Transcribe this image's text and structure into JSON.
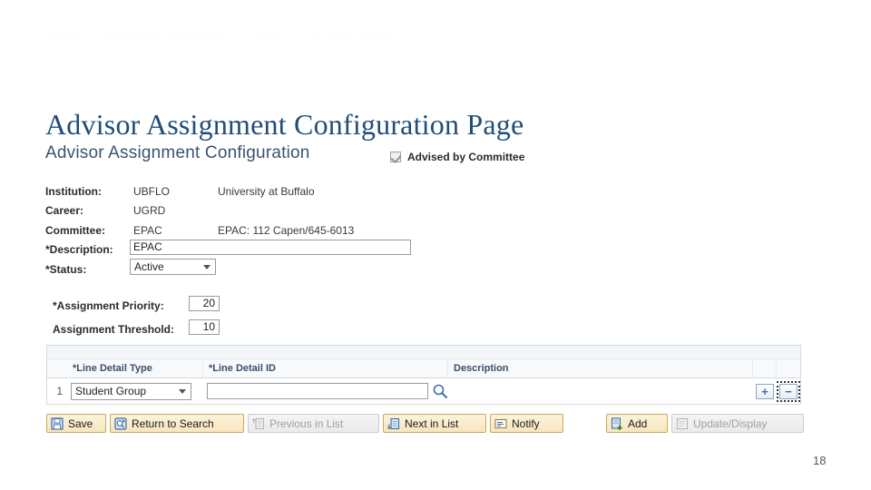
{
  "watermark": {
    "part1": "Advisor",
    "part2": "Assignment Configuration",
    "part3": "Page",
    "part4": "Committee Setup"
  },
  "page_title": "Advisor Assignment Configuration Page",
  "slide_number": "18",
  "form": {
    "subtitle": "Advisor Assignment Configuration",
    "committee_checkbox": {
      "label": "Advised by Committee",
      "checked": true
    },
    "fields": [
      {
        "label": "Institution:",
        "code": "UBFLO",
        "description": "University at Buffalo"
      },
      {
        "label": "Career:",
        "code": "UGRD",
        "description": ""
      },
      {
        "label": "Committee:",
        "code": "EPAC",
        "description": "EPAC: 112 Capen/645-6013"
      }
    ],
    "description": {
      "label": "*Description:",
      "value": "EPAC"
    },
    "status": {
      "label": "*Status:",
      "value": "Active"
    },
    "assignment_priority": {
      "label": "*Assignment Priority:",
      "value": "20"
    },
    "assignment_threshold": {
      "label": "Assignment Threshold:",
      "value": "10"
    }
  },
  "grid": {
    "columns": [
      {
        "key": "seq",
        "label": ""
      },
      {
        "key": "line_detail_type",
        "label": "*Line Detail Type"
      },
      {
        "key": "line_detail_id",
        "label": "*Line Detail ID"
      },
      {
        "key": "description",
        "label": "Description"
      }
    ],
    "rows": [
      {
        "seq": "1",
        "line_detail_type": "Student Group",
        "line_detail_id": "",
        "description": "",
        "lookup_icon": "search-icon",
        "add_row_label": "+",
        "delete_row_label": "−"
      }
    ]
  },
  "toolbar": {
    "buttons": [
      {
        "label": "Save",
        "icon": "save-disk-icon",
        "disabled": false
      },
      {
        "label": "Return to Search",
        "icon": "search-return-icon",
        "disabled": false
      },
      {
        "label": "Previous in List",
        "icon": "previous-list-icon",
        "disabled": true
      },
      {
        "label": "Next in List",
        "icon": "next-list-icon",
        "disabled": false
      },
      {
        "label": "Notify",
        "icon": "notify-envelope-icon",
        "disabled": false
      },
      {
        "label": "Add",
        "icon": "add-page-icon",
        "disabled": false
      },
      {
        "label": "Update/Display",
        "icon": "update-display-icon",
        "disabled": true
      }
    ]
  },
  "colors": {
    "title_blue": "#1F4E79",
    "subtitle_blue": "#3b5370",
    "grid_header_text": "#38506e",
    "button_border": "#c8a95e",
    "plus_minus_blue": "#3f6fa8"
  }
}
